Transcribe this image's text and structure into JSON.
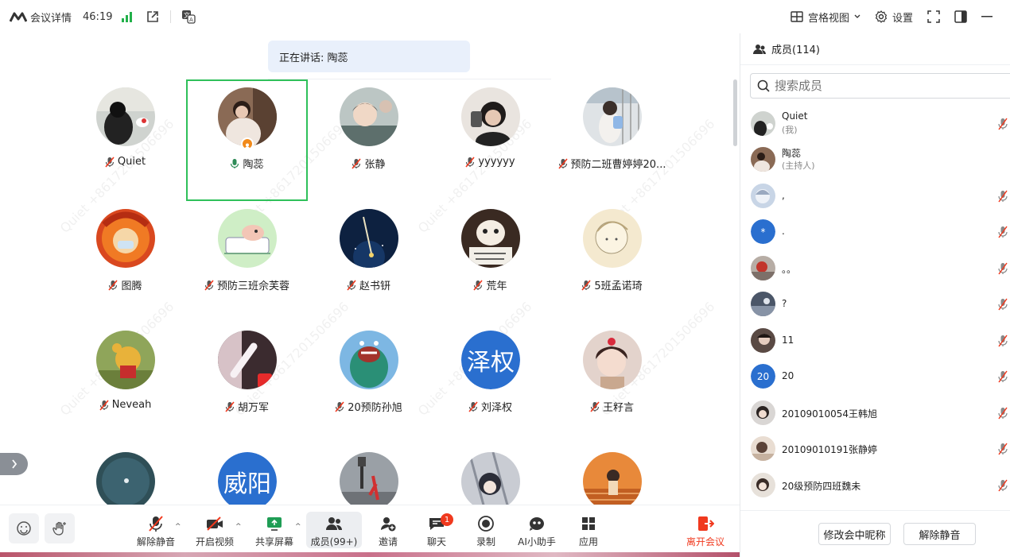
{
  "topbar": {
    "title": "会议详情",
    "time": "46:19",
    "view_label": "宫格视图",
    "settings_label": "设置"
  },
  "speaking": {
    "text": "正在讲话: 陶蕊"
  },
  "watermark": "Quiet +8617201506696",
  "tiles": [
    {
      "name": "Quiet",
      "mic": "muted"
    },
    {
      "name": "陶蕊",
      "mic": "speaking",
      "host": true
    },
    {
      "name": "张静",
      "mic": "muted"
    },
    {
      "name": "yyyyyy",
      "mic": "muted"
    },
    {
      "name": "预防二班曹婷婷20...",
      "mic": "muted"
    },
    {
      "name": "图腾",
      "mic": "muted"
    },
    {
      "name": "预防三班佘芙蓉",
      "mic": "muted"
    },
    {
      "name": "赵书钘",
      "mic": "muted"
    },
    {
      "name": "荒年",
      "mic": "muted"
    },
    {
      "name": "5班孟诺琦",
      "mic": "muted"
    },
    {
      "name": "Neveah",
      "mic": "muted"
    },
    {
      "name": "胡万军",
      "mic": "muted"
    },
    {
      "name": "20预防孙旭",
      "mic": "muted"
    },
    {
      "name": "刘泽权",
      "mic": "muted",
      "letter": "泽权"
    },
    {
      "name": "王籽言",
      "mic": "muted"
    },
    {
      "name": "",
      "mic": "muted"
    },
    {
      "name": "",
      "mic": "muted",
      "letter": "威阳"
    },
    {
      "name": "",
      "mic": "muted"
    },
    {
      "name": "",
      "mic": "muted"
    },
    {
      "name": "",
      "mic": "muted"
    }
  ],
  "toolbar": {
    "unmute": "解除静音",
    "video": "开启视频",
    "share": "共享屏幕",
    "members": "成员(99+)",
    "invite": "邀请",
    "chat": "聊天",
    "chat_badge": "1",
    "record": "录制",
    "ai": "AI小助手",
    "apps": "应用",
    "leave": "离开会议"
  },
  "panel": {
    "title": "成员(114)",
    "search_placeholder": "搜索成员",
    "members": [
      {
        "name": "Quiet",
        "sub": "(我)",
        "mic": "muted"
      },
      {
        "name": "陶蕊",
        "sub": "(主持人)",
        "mic": "none"
      },
      {
        "name": ",",
        "sub": "",
        "mic": "muted"
      },
      {
        "name": ".",
        "sub": "",
        "mic": "muted",
        "letter": "*"
      },
      {
        "name": "。。",
        "sub": "",
        "mic": "muted"
      },
      {
        "name": "?",
        "sub": "",
        "mic": "muted"
      },
      {
        "name": "11",
        "sub": "",
        "mic": "muted"
      },
      {
        "name": "20",
        "sub": "",
        "mic": "muted",
        "letter": "20"
      },
      {
        "name": "20109010054王韩旭",
        "sub": "",
        "mic": "muted"
      },
      {
        "name": "20109010191张静婷",
        "sub": "",
        "mic": "muted"
      },
      {
        "name": "20级预防四班魏未",
        "sub": "",
        "mic": "muted"
      }
    ],
    "rename_button": "修改会中昵称",
    "unmute_button": "解除静音"
  }
}
